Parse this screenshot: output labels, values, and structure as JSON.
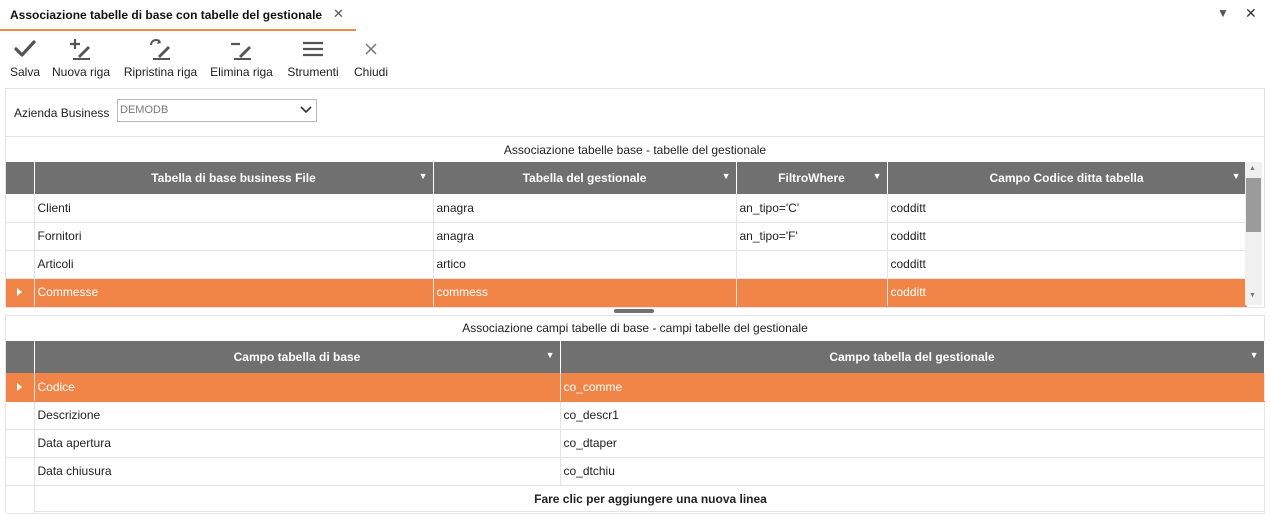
{
  "tab": {
    "title": "Associazione tabelle di base con tabelle del gestionale",
    "close_glyph": "✕"
  },
  "window": {
    "menu_glyph": "▼",
    "close_glyph": "✕"
  },
  "toolbar": {
    "save": {
      "label": "Salva",
      "icon": "check-icon"
    },
    "new_row": {
      "label": "Nuova riga",
      "icon": "add-row-icon"
    },
    "restore_row": {
      "label": "Ripristina riga",
      "icon": "restore-row-icon"
    },
    "delete_row": {
      "label": "Elimina riga",
      "icon": "delete-row-icon"
    },
    "tools": {
      "label": "Strumenti",
      "icon": "menu-icon"
    },
    "close": {
      "label": "Chiudi",
      "icon": "close-icon"
    }
  },
  "filter": {
    "label": "Azienda Business",
    "value": "DEMODB"
  },
  "grid1": {
    "caption": "Associazione tabelle base - tabelle del gestionale",
    "columns": [
      "Tabella di base business File",
      "Tabella del gestionale",
      "FiltroWhere",
      "Campo Codice ditta tabella"
    ],
    "rows": [
      [
        "Clienti",
        "anagra",
        "an_tipo='C'",
        "codditt"
      ],
      [
        "Fornitori",
        "anagra",
        "an_tipo='F'",
        "codditt"
      ],
      [
        "Articoli",
        "artico",
        "",
        "codditt"
      ],
      [
        "Commesse",
        "commess",
        "",
        "codditt"
      ]
    ],
    "selected_row": 3
  },
  "grid2": {
    "caption": "Associazione campi tabelle di base - campi tabelle del gestionale",
    "columns": [
      "Campo tabella di base",
      "Campo tabella del gestionale"
    ],
    "rows": [
      [
        "Codice",
        "co_comme"
      ],
      [
        "Descrizione",
        "co_descr1"
      ],
      [
        "Data apertura",
        "co_dtaper"
      ],
      [
        "Data chiusura",
        "co_dtchiu"
      ]
    ],
    "selected_row": 0,
    "new_row_text": "Fare clic per aggiungere una nuova linea"
  },
  "colors": {
    "accent": "#f08547",
    "header": "#707070"
  }
}
